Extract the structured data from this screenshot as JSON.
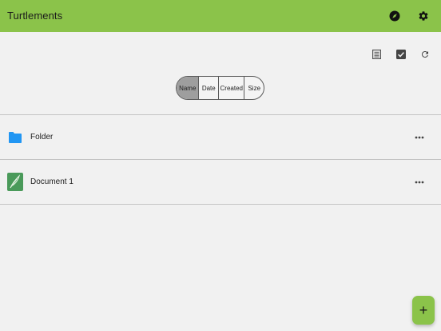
{
  "appbar": {
    "title": "Turtlements",
    "icons": [
      "compass-icon",
      "settings-icon"
    ],
    "color": "#8bc34a"
  },
  "toolbar": {
    "icons": [
      "list-view-icon",
      "select-checkbox-icon",
      "refresh-icon"
    ]
  },
  "sort": {
    "options": [
      "Name",
      "Date",
      "Created",
      "Size"
    ],
    "selected": "Name"
  },
  "items": [
    {
      "label": "Folder",
      "icon": "folder-icon",
      "icon_color": "#2196f3"
    },
    {
      "label": "Document 1",
      "icon": "document-quill-icon",
      "icon_color": "#4a9a5a"
    }
  ],
  "fab": {
    "label": "+"
  }
}
